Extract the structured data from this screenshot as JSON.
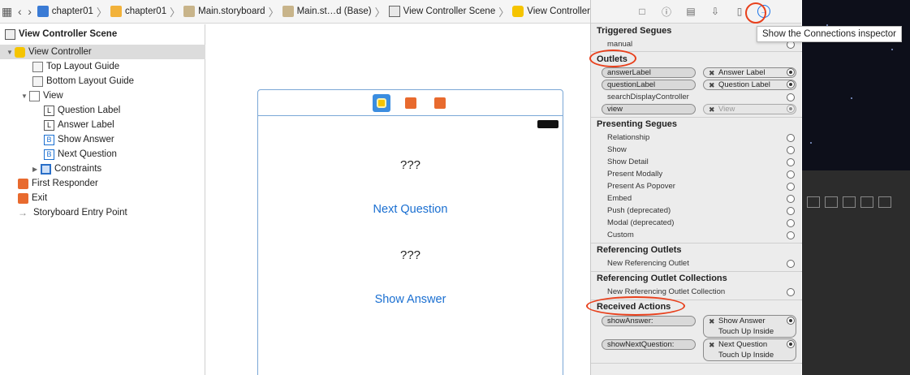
{
  "jumpbar": {
    "crumbs": [
      "chapter01",
      "chapter01",
      "Main.storyboard",
      "Main.st…d (Base)",
      "View Controller Scene",
      "View Controller"
    ]
  },
  "outline": {
    "items": [
      {
        "label": "View Controller Scene"
      },
      {
        "label": "View Controller"
      },
      {
        "label": "Top Layout Guide"
      },
      {
        "label": "Bottom Layout Guide"
      },
      {
        "label": "View"
      },
      {
        "label": "Question Label",
        "badge": "L"
      },
      {
        "label": "Answer Label",
        "badge": "L"
      },
      {
        "label": "Show Answer",
        "badge": "B"
      },
      {
        "label": "Next Question",
        "badge": "B"
      },
      {
        "label": "Constraints"
      },
      {
        "label": "First Responder"
      },
      {
        "label": "Exit"
      },
      {
        "label": "Storyboard Entry Point"
      }
    ]
  },
  "scene": {
    "question_text": "???",
    "next_question": "Next Question",
    "answer_text": "???",
    "show_answer": "Show Answer"
  },
  "inspector": {
    "tooltip": "Show the Connections inspector",
    "triggered_segues": {
      "title": "Triggered Segues",
      "items": [
        "manual"
      ]
    },
    "outlets": {
      "title": "Outlets",
      "items": [
        {
          "name": "answerLabel",
          "target": "Answer Label"
        },
        {
          "name": "questionLabel",
          "target": "Question Label"
        },
        {
          "name": "searchDisplayController",
          "target": ""
        },
        {
          "name": "view",
          "target": "View"
        }
      ]
    },
    "presenting_segues": {
      "title": "Presenting Segues",
      "items": [
        "Relationship",
        "Show",
        "Show Detail",
        "Present Modally",
        "Present As Popover",
        "Embed",
        "Push (deprecated)",
        "Modal (deprecated)",
        "Custom"
      ]
    },
    "referencing_outlets": {
      "title": "Referencing Outlets",
      "items": [
        "New Referencing Outlet"
      ]
    },
    "referencing_outlet_collections": {
      "title": "Referencing Outlet Collections",
      "items": [
        "New Referencing Outlet Collection"
      ]
    },
    "received_actions": {
      "title": "Received Actions",
      "items": [
        {
          "name": "showAnswer:",
          "target": "Show Answer",
          "event": "Touch Up Inside"
        },
        {
          "name": "showNextQuestion:",
          "target": "Next Question",
          "event": "Touch Up Inside"
        }
      ]
    }
  },
  "colors": {
    "accent": "#1a73e8",
    "annotation": "#e8401c",
    "scene_border": "#7aa7d6"
  }
}
